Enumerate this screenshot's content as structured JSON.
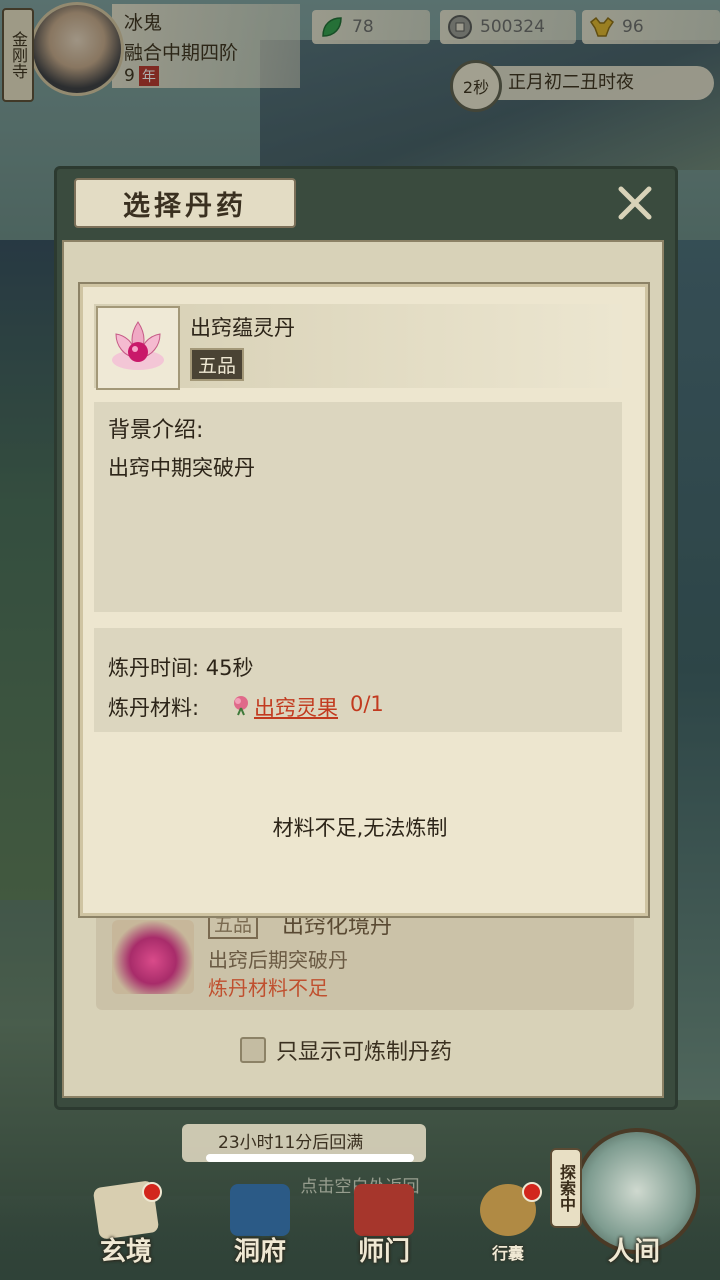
{
  "player": {
    "sect": "金刚寺",
    "name": "冰鬼",
    "realm": "融合中期四阶",
    "age": "9",
    "age_unit": "年"
  },
  "resources": [
    {
      "icon": "jade-leaf-icon",
      "value": "78"
    },
    {
      "icon": "coin-icon",
      "value": "500324"
    },
    {
      "icon": "strength-icon",
      "value": "96"
    }
  ],
  "time": {
    "countdown": "2秒",
    "date": "正月初二丑时夜"
  },
  "modal": {
    "title": "选择丹药",
    "close_icon": "close-icon",
    "under_item": {
      "grade": "五品",
      "name": "出窍化境丹",
      "desc": "出窍后期突破丹",
      "warning": "炼丹材料不足"
    },
    "filter_label": "只显示可炼制丹药"
  },
  "detail": {
    "pill_name": "出窍蕴灵丹",
    "grade": "五品",
    "background_title": "背景介绍:",
    "background_desc": "出窍中期突破丹",
    "time_label": "炼丹时间:",
    "time_value": "45秒",
    "material_label": "炼丹材料:",
    "material_name": "出窍灵果",
    "material_count": "0/1",
    "status": "材料不足,无法炼制"
  },
  "bottom": {
    "regen": "23小时11分后回满",
    "back_hint": "点击空白处返回",
    "nav": [
      {
        "label": "玄境",
        "badge": true
      },
      {
        "label": "洞府",
        "badge": false
      },
      {
        "label": "师门",
        "badge": false
      },
      {
        "label": "行囊",
        "badge": true
      },
      {
        "label": "人间",
        "badge": false
      }
    ],
    "explore": "探索中"
  },
  "colors": {
    "warning": "#c23a1f",
    "badge": "#d2261c",
    "modal_frame": "#3a4b3e"
  }
}
